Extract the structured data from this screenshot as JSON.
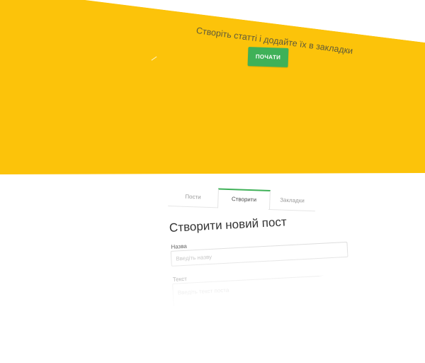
{
  "hero": {
    "title": "Створіть статті і додайте їх в закладки",
    "start_button": "ПОЧАТИ"
  },
  "tabs": [
    {
      "label": "Пости",
      "active": false
    },
    {
      "label": "Створити",
      "active": true
    },
    {
      "label": "Закладки",
      "active": false
    }
  ],
  "form": {
    "heading": "Створити новий пост",
    "title_label": "Назва",
    "title_placeholder": "Введіть назву",
    "text_label": "Текст",
    "text_placeholder": "Введіть текст поста"
  },
  "colors": {
    "hero_background": "#fcc30a",
    "accent_green": "#3fb158"
  }
}
